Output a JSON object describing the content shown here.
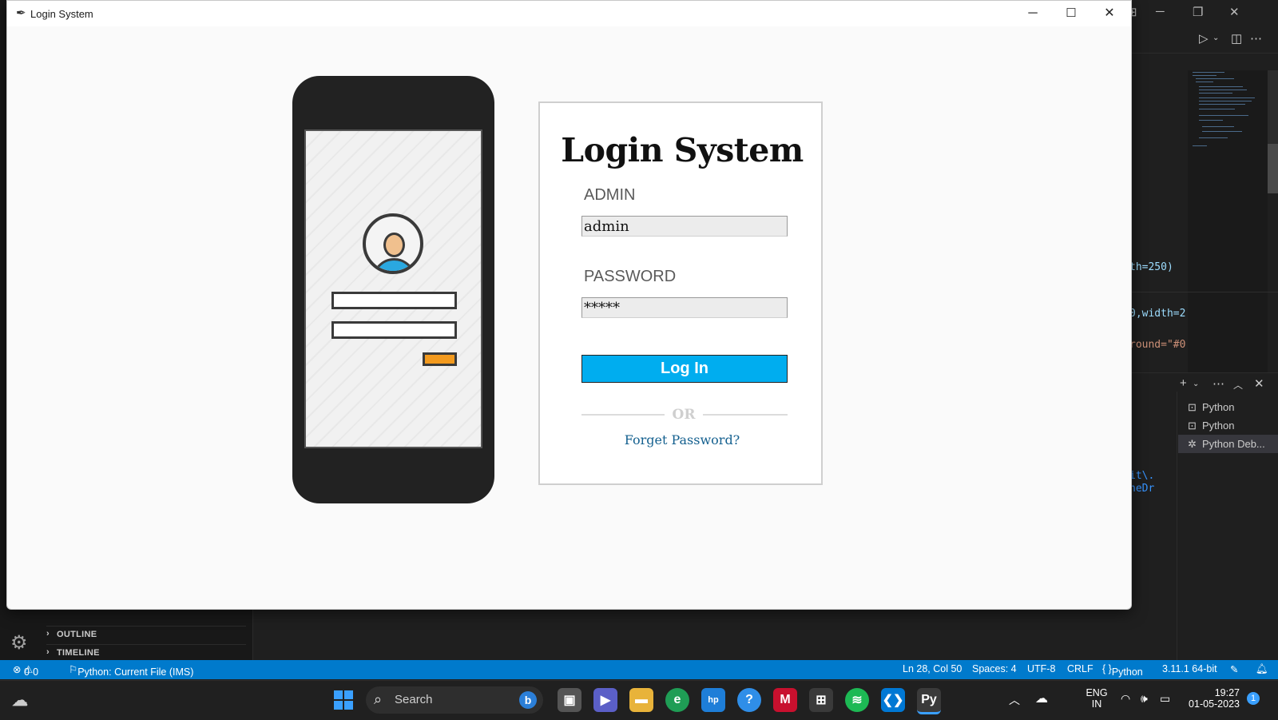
{
  "window": {
    "title": "Login System",
    "minimize_glyph": "─",
    "maximize_glyph": "☐",
    "close_glyph": "✕"
  },
  "login": {
    "heading": "Login System",
    "username_label": "ADMIN",
    "username_value": "admin",
    "password_label": "PASSWORD",
    "password_value": "*****",
    "login_button": "Log In",
    "or_text": "OR",
    "forgot_link": "Forget Password?"
  },
  "vscode": {
    "code_fragments": [
      "th=250)",
      "0,width=2",
      "round=\"#0",
      "it\\.",
      "neDr"
    ],
    "terminals": [
      {
        "label": "Python",
        "icon": "terminal-icon"
      },
      {
        "label": "Python",
        "icon": "terminal-icon"
      },
      {
        "label": "Python Deb...",
        "icon": "debug-icon"
      }
    ],
    "sidebar_sections": [
      "OUTLINE",
      "TIMELINE"
    ]
  },
  "statusbar": {
    "errors": "0",
    "warnings": "0",
    "run_config": "Python: Current File (IMS)",
    "cursor": "Ln 28, Col 50",
    "spaces": "Spaces: 4",
    "encoding": "UTF-8",
    "eol": "CRLF",
    "language": "Python",
    "interpreter": "3.11.1 64-bit"
  },
  "taskbar": {
    "search_placeholder": "Search",
    "lang_top": "ENG",
    "lang_bottom": "IN",
    "time": "19:27",
    "date": "01-05-2023",
    "notification_count": "1"
  },
  "colors": {
    "accent_blue": "#00adef",
    "status_blue": "#007acc",
    "link": "#14608f",
    "phone_button": "#f39a1e"
  }
}
